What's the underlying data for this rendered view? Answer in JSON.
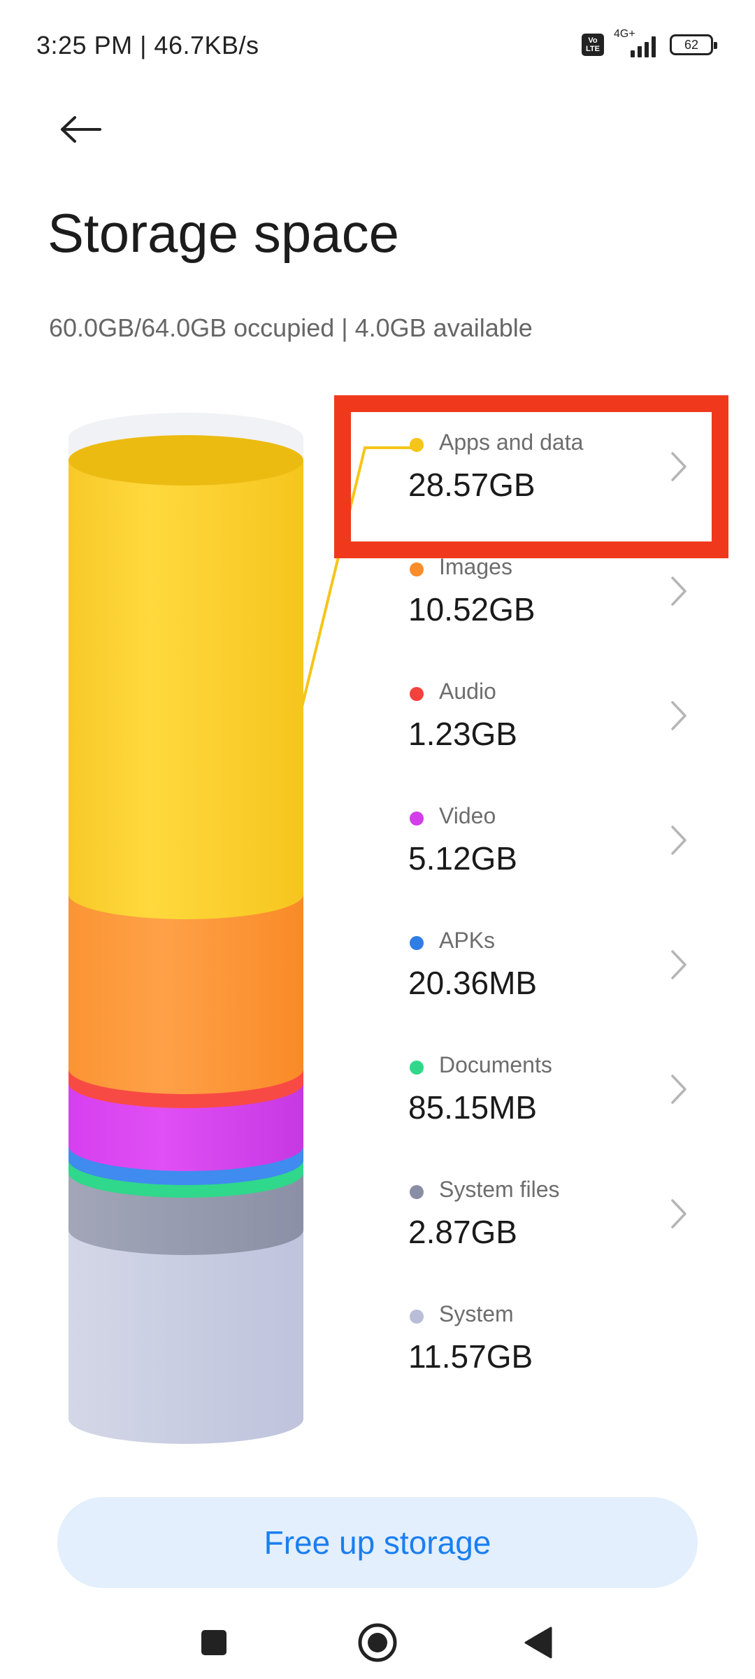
{
  "status_bar": {
    "time_speed": "3:25 PM | 46.7KB/s",
    "volte_top": "Vo",
    "volte_bottom": "LTE",
    "network": "4G+",
    "battery": "62"
  },
  "header": {
    "title": "Storage space",
    "summary": "60.0GB/64.0GB occupied | 4.0GB available"
  },
  "storage_items": [
    {
      "label": "Apps and data",
      "value": "28.57GB",
      "color": "#f5c518",
      "has_chevron": true
    },
    {
      "label": "Images",
      "value": "10.52GB",
      "color": "#fb8c2c",
      "has_chevron": true
    },
    {
      "label": "Audio",
      "value": "1.23GB",
      "color": "#f5413d",
      "has_chevron": true
    },
    {
      "label": "Video",
      "value": "5.12GB",
      "color": "#d23ee8",
      "has_chevron": true
    },
    {
      "label": "APKs",
      "value": "20.36MB",
      "color": "#2f7ee6",
      "has_chevron": true
    },
    {
      "label": "Documents",
      "value": "85.15MB",
      "color": "#2fd88a",
      "has_chevron": true
    },
    {
      "label": "System files",
      "value": "2.87GB",
      "color": "#8a8ea4",
      "has_chevron": true
    },
    {
      "label": "System",
      "value": "11.57GB",
      "color": "#b9bdd8",
      "has_chevron": false
    }
  ],
  "free_up_button": "Free up storage",
  "colors": {
    "accent": "#1a7ff0",
    "highlight": "#f0391c"
  }
}
